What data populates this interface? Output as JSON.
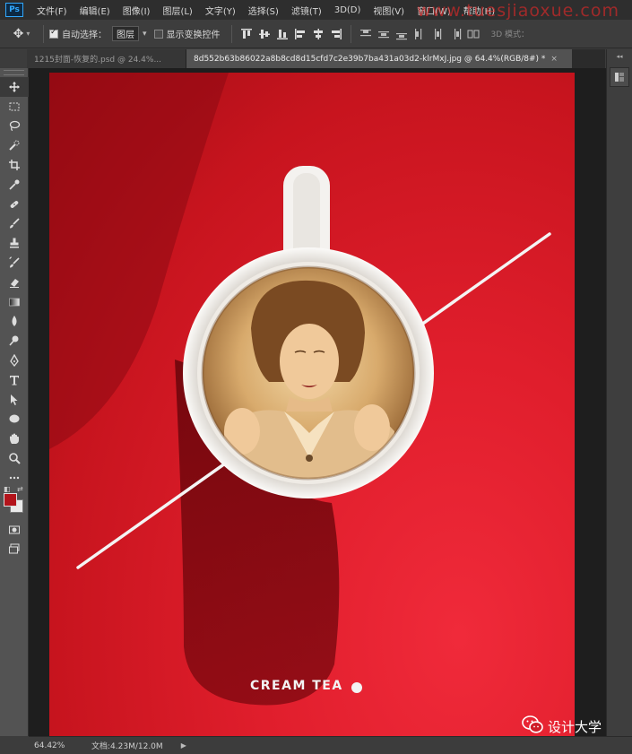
{
  "app": {
    "logo": "Ps"
  },
  "menu": [
    "文件(F)",
    "编辑(E)",
    "图像(I)",
    "图层(L)",
    "文字(Y)",
    "选择(S)",
    "滤镜(T)",
    "3D(D)",
    "视图(V)",
    "窗口(W)",
    "帮助(H)"
  ],
  "watermark": "www.tuesjiaoxue.com",
  "options": {
    "auto_select_label": "自动选择：",
    "auto_select_checked": true,
    "auto_select_target": "图层",
    "show_transform_label": "显示变换控件",
    "show_transform_checked": false,
    "mode_3d_label": "3D 模式："
  },
  "tabs": [
    {
      "label": "1215封面-恢复的.psd @ 24.4%...",
      "active": false
    },
    {
      "label": "8d552b63b86022a8b8cd8d15cfd7c2e39b7ba431a03d2-klrMxJ.jpg @ 64.4%(RGB/8#) *",
      "active": true,
      "close": "×"
    }
  ],
  "tools": [
    "move-icon",
    "marquee-icon",
    "lasso-icon",
    "quick-select-icon",
    "crop-icon",
    "eyedropper-icon",
    "healing-icon",
    "brush-icon",
    "stamp-icon",
    "history-brush-icon",
    "eraser-icon",
    "gradient-icon",
    "blur-icon",
    "dodge-icon",
    "pen-icon",
    "type-icon",
    "path-select-icon",
    "ellipse-icon",
    "hand-icon",
    "zoom-icon",
    "more-icon"
  ],
  "colors": {
    "foreground": "#b3141b",
    "background": "#e9e9e9",
    "canvas_red": "#e01e2c",
    "accent": "#31a8ff"
  },
  "canvas": {
    "caption": "CREAM TEA"
  },
  "status": {
    "zoom": "64.42%",
    "doc": "文档:4.23M/12.0M",
    "arrow": "▶"
  },
  "overlay": {
    "wechat_label": "设计大学"
  }
}
